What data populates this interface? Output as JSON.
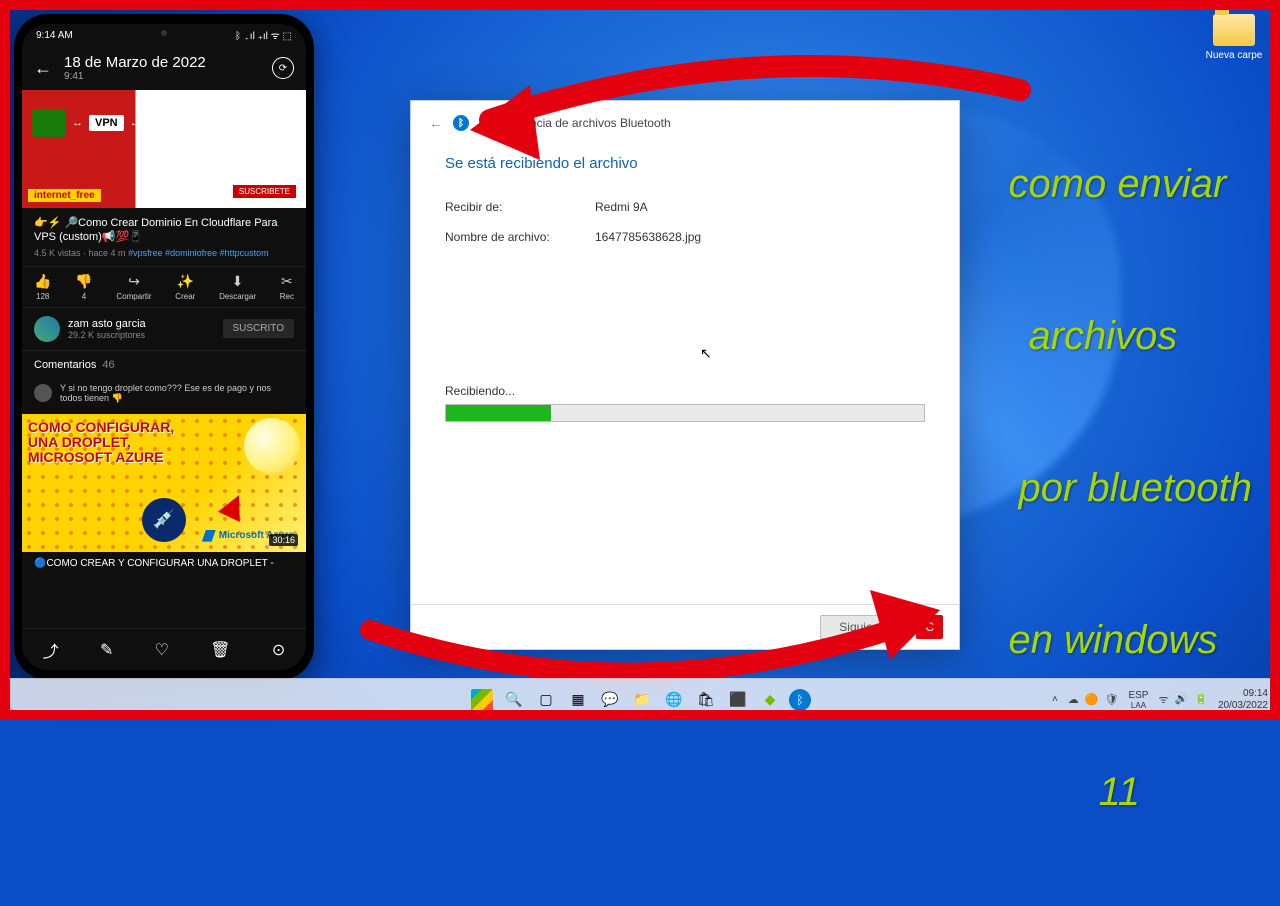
{
  "desktop": {
    "folder_label": "Nueva carpe"
  },
  "dialog": {
    "title": "Transferencia de archivos Bluetooth",
    "heading": "Se está recibiendo el archivo",
    "receive_from_label": "Recibir de:",
    "receive_from_value": "Redmi 9A",
    "filename_label": "Nombre de archivo:",
    "filename_value": "1647785638628.jpg",
    "progress_label": "Recibiendo...",
    "progress_pct": 22,
    "btn_next": "Siguiente",
    "btn_cancel": "C"
  },
  "phone": {
    "status_time": "9:14 AM",
    "status_icons": "ᛒ  ₊ıl ₊ıl ᯤ ⬚ ",
    "gallery_date": "18 de Marzo de 2022",
    "gallery_time": "9:41",
    "video": {
      "banner": "internet_free",
      "vpn": "VPN",
      "subscribe_mini": "SUSCRIBETE",
      "title": "👉⚡ 🔎Como Crear Dominio En  Cloudflare Para VPS (custom)📢💯📱",
      "stats": "4.5 K vistas · hace 4 m",
      "tags": "#vpsfree #dominiofree #httpcustom",
      "like_count": "128",
      "dislike_count": "4",
      "share": "Compartir",
      "create": "Crear",
      "download": "Descargar",
      "rec": "Rec"
    },
    "channel": {
      "name": "zam asto garcia",
      "subs": "29.2 K suscriptores",
      "subscribed": "SUSCRITO"
    },
    "comments": {
      "label": "Comentarios",
      "count": "46",
      "sample": "Y si no tengo droplet como??? Ese es de pago y nos todos tienen 👎"
    },
    "next": {
      "thumb_text": "COMO CONFIGURAR,\nUNA DROPLET,\nMICROSOFT AZURE",
      "azure": "Microsoft\nAzure",
      "duration": "30:16",
      "title": "🔵COMO CREAR Y CONFIGURAR UNA DROPLET -"
    }
  },
  "overlay": {
    "line1": "como enviar",
    "line2": "archivos",
    "line3": "por bluetooth",
    "line4": "en  windows",
    "line5": "11"
  },
  "taskbar": {
    "lang": "ESP",
    "layout": "LAA",
    "time": "09:14",
    "date": "20/03/2022"
  }
}
